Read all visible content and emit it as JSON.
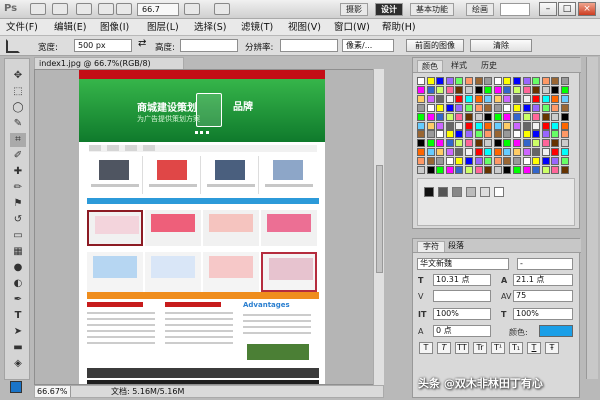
{
  "app": {
    "logo": "Ps",
    "zoom_value": "66.7",
    "workspaces": [
      "摄影",
      "设计",
      "基本功能",
      "绘画"
    ]
  },
  "menu": [
    "文件(F)",
    "编辑(E)",
    "图像(I)",
    "图层(L)",
    "选择(S)",
    "滤镜(T)",
    "视图(V)",
    "窗口(W)",
    "帮助(H)"
  ],
  "options": {
    "width_label": "宽度:",
    "width_value": "500 px",
    "height_label": "高度:",
    "resolution_label": "分辨率:",
    "unit_value": "像素/...",
    "front_image_btn": "前面的图像",
    "clear_btn": "清除"
  },
  "document": {
    "tab_title": "index1.jpg @ 66.7%(RGB/8)",
    "zoom_status": "66.67%",
    "doc_info": "文档: 5.16M/5.16M"
  },
  "web": {
    "banner_title": "商城建设策划",
    "banner_brand": "品牌",
    "banner_sub": "为广告提供策划方案",
    "adv_title": "Advantages"
  },
  "swatches": {
    "tabs": [
      "颜色",
      "样式",
      "历史"
    ],
    "colors": [
      "#ffffff",
      "#000000",
      "#ff0000",
      "#ffff00",
      "#00ff00",
      "#00ffff",
      "#0000ff",
      "#ff00ff",
      "#ff6600",
      "#9966ff",
      "#3366cc",
      "#66ccff",
      "#66ff66",
      "#ccff66",
      "#ffcc66",
      "#ff9966",
      "#ff6699",
      "#cc66ff",
      "#996633",
      "#663300",
      "#666666",
      "#999999",
      "#cccccc",
      "#f2f2f2"
    ]
  },
  "character": {
    "tabs": [
      "字符",
      "段落"
    ],
    "font_family": "华文新魏",
    "font_style": "-",
    "size": "10.31 点",
    "leading": "21.1 点",
    "tracking": "75",
    "scale_v": "100%",
    "scale_h": "100%",
    "baseline": "0 点",
    "color_label": "颜色:",
    "buttons": [
      "T",
      "T",
      "TT",
      "Tr",
      "T¹",
      "T₁",
      "T",
      "Ŧ"
    ]
  },
  "watermark": "头条 @双木非林田丁有心"
}
